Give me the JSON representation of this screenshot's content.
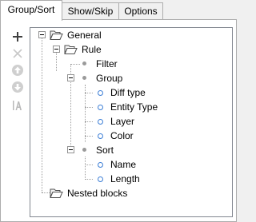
{
  "tabs": [
    {
      "label": "Group/Sort",
      "active": true
    },
    {
      "label": "Show/Skip",
      "active": false
    },
    {
      "label": "Options",
      "active": false
    }
  ],
  "toolbar": {
    "buttons": [
      {
        "name": "add",
        "icon": "plus-icon",
        "enabled": true
      },
      {
        "name": "remove",
        "icon": "x-icon",
        "enabled": false
      },
      {
        "name": "move-up",
        "icon": "arrow-up-circle-icon",
        "enabled": false
      },
      {
        "name": "move-down",
        "icon": "arrow-down-circle-icon",
        "enabled": false
      },
      {
        "name": "rename",
        "icon": "text-rename-icon",
        "enabled": false
      }
    ]
  },
  "tree": {
    "general": "General",
    "rule": "Rule",
    "filter": "Filter",
    "group": "Group",
    "diff_type": "Diff type",
    "entity_type": "Entity Type",
    "layer": "Layer",
    "color": "Color",
    "sort": "Sort",
    "name": "Name",
    "length": "Length",
    "nested_blocks": "Nested blocks"
  },
  "colors": {
    "ring_accent": "#3d7fd6",
    "folder": "#f5f5f5",
    "border": "#adadad"
  }
}
